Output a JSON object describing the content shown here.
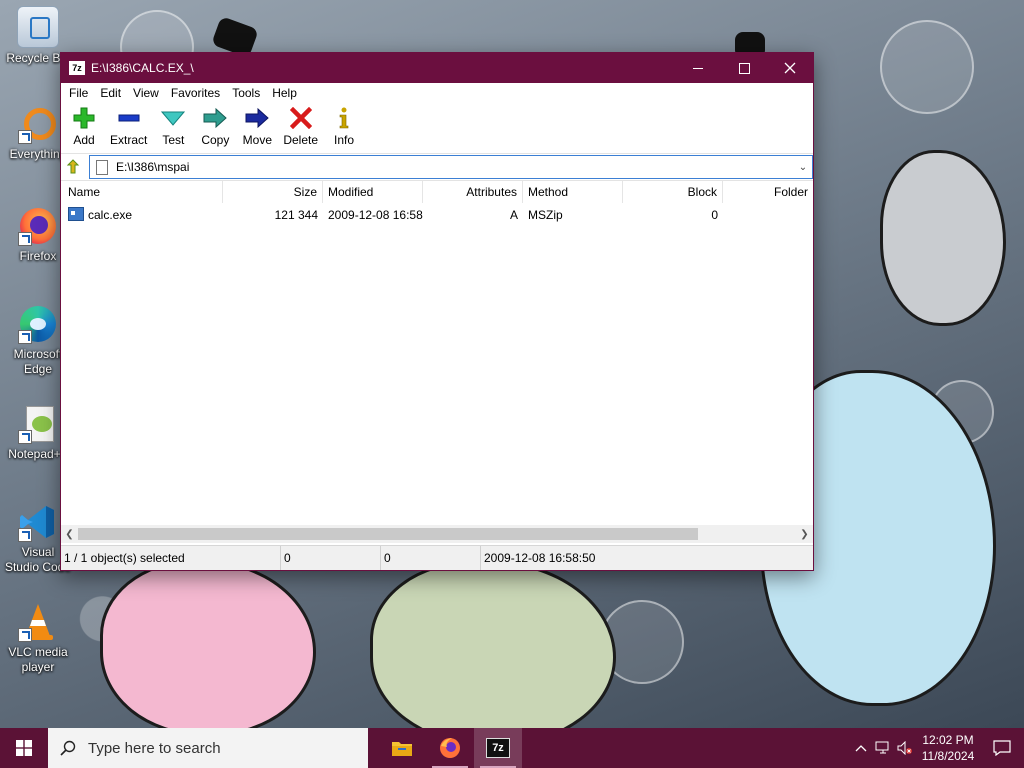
{
  "desktop": {
    "icons": [
      {
        "label": "Recycle Bin",
        "icon": "recycle-bin-icon"
      },
      {
        "label": "Everything",
        "icon": "everything-search-icon"
      },
      {
        "label": "Firefox",
        "icon": "firefox-icon"
      },
      {
        "label": "Microsoft Edge",
        "icon": "edge-icon"
      },
      {
        "label": "Notepad++",
        "icon": "notepad-plus-plus-icon"
      },
      {
        "label": "Visual Studio Code",
        "icon": "vscode-icon"
      },
      {
        "label": "VLC media player",
        "icon": "vlc-icon"
      }
    ]
  },
  "window": {
    "title": "E:\\I386\\CALC.EX_\\",
    "app_icon_text": "7z",
    "menu": [
      "File",
      "Edit",
      "View",
      "Favorites",
      "Tools",
      "Help"
    ],
    "toolbar": [
      {
        "label": "Add",
        "icon": "add-plus-icon"
      },
      {
        "label": "Extract",
        "icon": "extract-minus-icon"
      },
      {
        "label": "Test",
        "icon": "test-check-icon"
      },
      {
        "label": "Copy",
        "icon": "copy-arrow-icon"
      },
      {
        "label": "Move",
        "icon": "move-arrow-icon"
      },
      {
        "label": "Delete",
        "icon": "delete-x-icon"
      },
      {
        "label": "Info",
        "icon": "info-icon"
      }
    ],
    "address": {
      "value": "E:\\I386\\mspai"
    },
    "columns": [
      "Name",
      "Size",
      "Modified",
      "Attributes",
      "Method",
      "Block",
      "Folder"
    ],
    "rows": [
      {
        "name": "calc.exe",
        "size": "121 344",
        "modified": "2009-12-08 16:58",
        "attributes": "A",
        "method": "MSZip",
        "block": "0",
        "folder": ""
      }
    ],
    "status": {
      "selection": "1 / 1 object(s) selected",
      "size": "0",
      "packed": "0",
      "modified": "2009-12-08 16:58:50"
    }
  },
  "taskbar": {
    "search_placeholder": "Type here to search",
    "apps": [
      "file-explorer-icon",
      "firefox-icon",
      "7zip-icon"
    ],
    "time": "12:02 PM",
    "date": "11/8/2024"
  },
  "colors": {
    "accent": "#6b0f3f",
    "taskbar": "#5b1236"
  }
}
